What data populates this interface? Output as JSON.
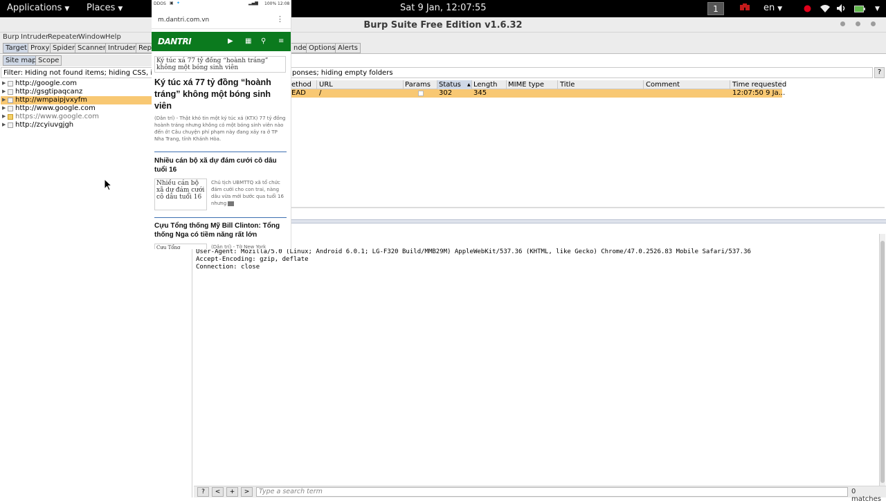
{
  "topbar": {
    "applications": "Applications",
    "places": "Places",
    "clock": "Sat  9 Jan, 12:07:55",
    "workspace": "1",
    "language": "en"
  },
  "window": {
    "title": "Burp Suite Free Edition v1.6.32"
  },
  "menu": [
    "Burp",
    "Intruder",
    "Repeater",
    "Window",
    "Help"
  ],
  "main_tabs": [
    "Target",
    "Proxy",
    "Spider",
    "Scanner",
    "Intruder",
    "Repe",
    "nder",
    "Options",
    "Alerts"
  ],
  "sub_tabs": [
    "Site map",
    "Scope"
  ],
  "filter": {
    "left": "Filter: Hiding not found items;  hiding CSS, imag",
    "right": "ponses;  hiding empty folders",
    "help": "?"
  },
  "site_tree": [
    {
      "host": "http://google.com"
    },
    {
      "host": "http://gsgtipaqcanz"
    },
    {
      "host": "http://wmpaipjvxyfm"
    },
    {
      "host": "http://www.google.com"
    },
    {
      "host": "https://www.google.com"
    },
    {
      "host": "http://zcyiuvgjgh"
    }
  ],
  "table": {
    "columns": [
      "ethod",
      "URL",
      "Params",
      "Status",
      "Length",
      "MIME type",
      "Title",
      "Comment",
      "Time requested"
    ],
    "rows": [
      {
        "method": "EAD",
        "url": "/",
        "status": "302",
        "length": "345",
        "time": "12:07:50 9 Ja..."
      }
    ]
  },
  "request_lines": [
    "User-Agent: Mozilla/5.0 (Linux; Android 6.0.1; LG-F320 Build/MMB29M) AppleWebKit/537.36 (KHTML, like Gecko) Chrome/47.0.2526.83 Mobile Safari/537.36",
    "Accept-Encoding: gzip, deflate",
    "Connection: close"
  ],
  "search": {
    "placeholder": "Type a search term",
    "help": "?",
    "prev": "<",
    "add": "+",
    "next": ">",
    "matches": "0 matches"
  },
  "phone": {
    "status_left": "DDOS",
    "status_right": "100% 12:08",
    "url": "m.dantri.com.vn",
    "brand": "DANTRI",
    "article1_img_alt": "Ký túc xá 77 tỷ đồng “hoành tráng” không một bóng sinh viên",
    "article1_title": "Ký túc xá 77 tỷ đồng “hoành tráng” không một bóng sinh viên",
    "article1_summary": "(Dân trí) - Thật khó tin một ký túc xá (KTX) 77 tỷ đồng hoành tráng nhưng không có một bóng sinh viên nào đến ở! Câu chuyện phí phạm này đang xảy ra ở TP Nha Trang, tỉnh Khánh Hòa.",
    "article2_title": "Nhiều cán bộ xã dự đám cưới cô dâu tuổi 16",
    "article2_img_alt": "Nhiều cán bộ xã dự đám cưới cô dâu tuổi 16",
    "article2_summary": "Chủ tịch UBMTTQ xã tổ chức đám cưới cho con trai, nàng dâu vừa mới bước qua tuổi 16 nhưng",
    "article3_title": "Cựu Tổng thống Mỹ Bill Clinton: Tổng thống Nga có tiềm năng rất lớn",
    "article3_img_alt": "Cựu Tổng",
    "article3_summary": "(Dân trí) - Tờ New York"
  },
  "colors": {
    "highlight": "#f8c873",
    "brand_green": "#0b7a1e",
    "topbar": "#000000"
  }
}
